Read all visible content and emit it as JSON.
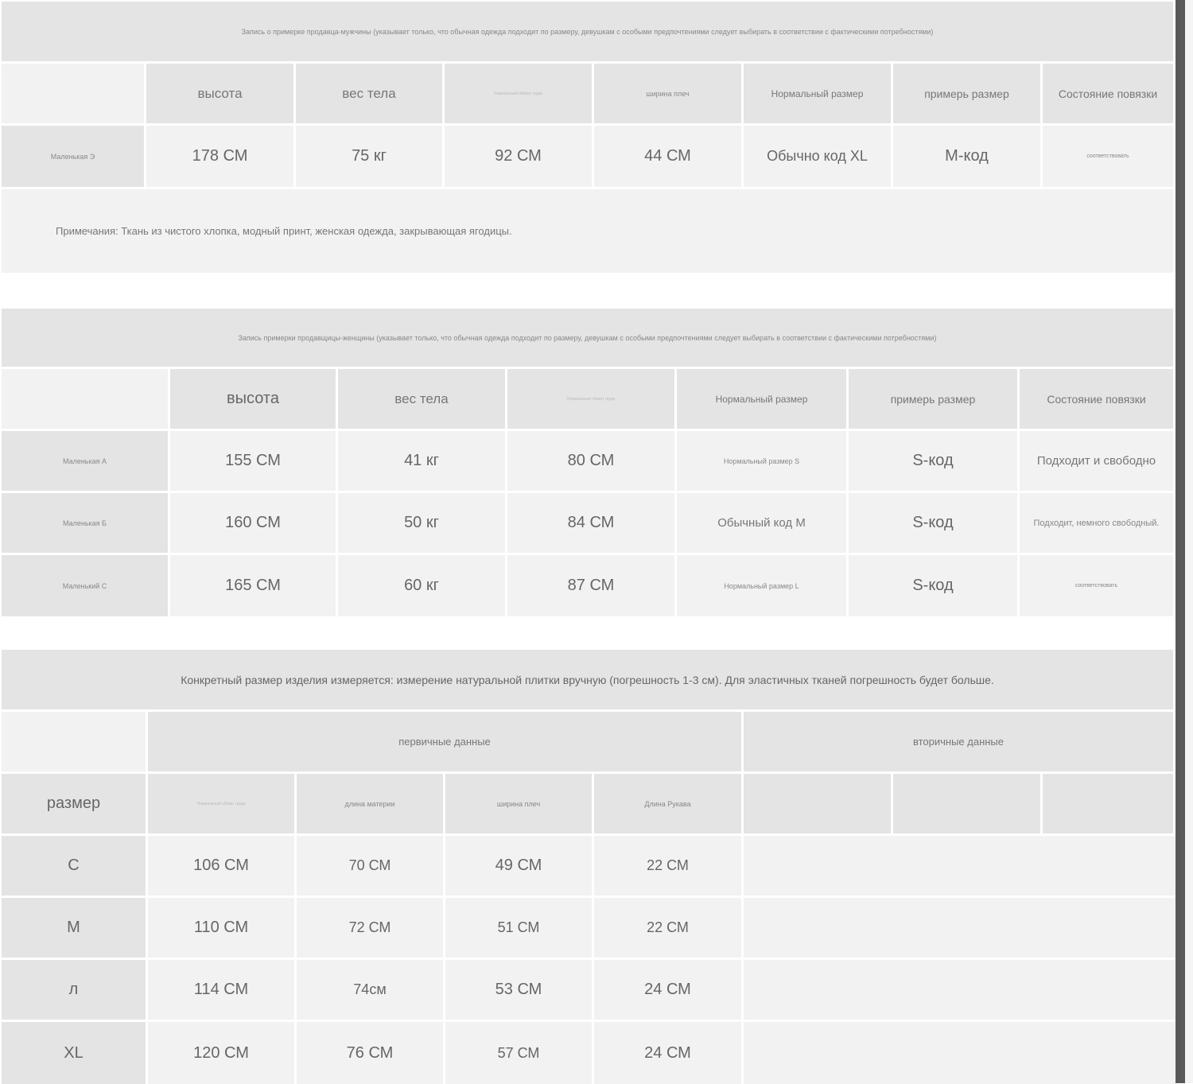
{
  "table1": {
    "title": "Запись о примерке продавца-мужчины (указывает только, что обычная одежда подходит по размеру, девушкам с особыми предпочтениями следует выбирать в соответствии с фактическими потребностями)",
    "headers": [
      "высота",
      "вес тела",
      "Нормальный обхват груди",
      "ширина плеч",
      "Нормальный размер",
      "примерь размер",
      "Состояние повязки"
    ],
    "rows": [
      {
        "name": "Маленькая Э",
        "cells": [
          "178 СМ",
          "75 кг",
          "92 СМ",
          "44 СМ",
          "Обычно код XL",
          "M-код",
          "соответствовать"
        ]
      }
    ],
    "note": "Примечания: Ткань из чистого хлопка, модный принт, женская одежда, закрывающая ягодицы."
  },
  "table2": {
    "title": "Запись примерки продавщицы-женщины (указывает только, что обычная одежда подходит по размеру, девушкам с особыми предпочтениями следует выбирать в соответствии с фактическими потребностями)",
    "headers": [
      "высота",
      "вес тела",
      "Нормальный обхват груди",
      "Нормальный размер",
      "примерь размер",
      "Состояние повязки"
    ],
    "rows": [
      {
        "name": "Маленькая А",
        "cells": [
          "155 СМ",
          "41 кг",
          "80 СМ",
          "Нормальный размер S",
          "S-код",
          "Подходит и свободно"
        ]
      },
      {
        "name": "Маленькая Б",
        "cells": [
          "160 СМ",
          "50 кг",
          "84 СМ",
          "Обычный код M",
          "S-код",
          "Подходит, немного свободный."
        ]
      },
      {
        "name": "Маленький С",
        "cells": [
          "165 СМ",
          "60 кг",
          "87 СМ",
          "Нормальный размер L",
          "S-код",
          "соответствовать"
        ]
      }
    ]
  },
  "table3": {
    "title": "Конкретный размер изделия измеряется: измерение натуральной плитки вручную (погрешность 1-3 см). Для эластичных тканей погрешность будет больше.",
    "group_primary": "первичные данные",
    "group_secondary": "вторичные данные",
    "size_header": "размер",
    "headers": [
      "Нормальный обхват груди",
      "длина материи",
      "ширина плеч",
      "Длина Рукава"
    ],
    "rows": [
      {
        "size": "С",
        "cells": [
          "106 СМ",
          "70 СМ",
          "49 СМ",
          "22 СМ"
        ]
      },
      {
        "size": "M",
        "cells": [
          "110 СМ",
          "72 СМ",
          "51 СМ",
          "22 СМ"
        ]
      },
      {
        "size": "л",
        "cells": [
          "114 СМ",
          "74см",
          "53 СМ",
          "24 СМ"
        ]
      },
      {
        "size": "XL",
        "cells": [
          "120 СМ",
          "76 СМ",
          "57 СМ",
          "24 СМ"
        ]
      }
    ]
  }
}
